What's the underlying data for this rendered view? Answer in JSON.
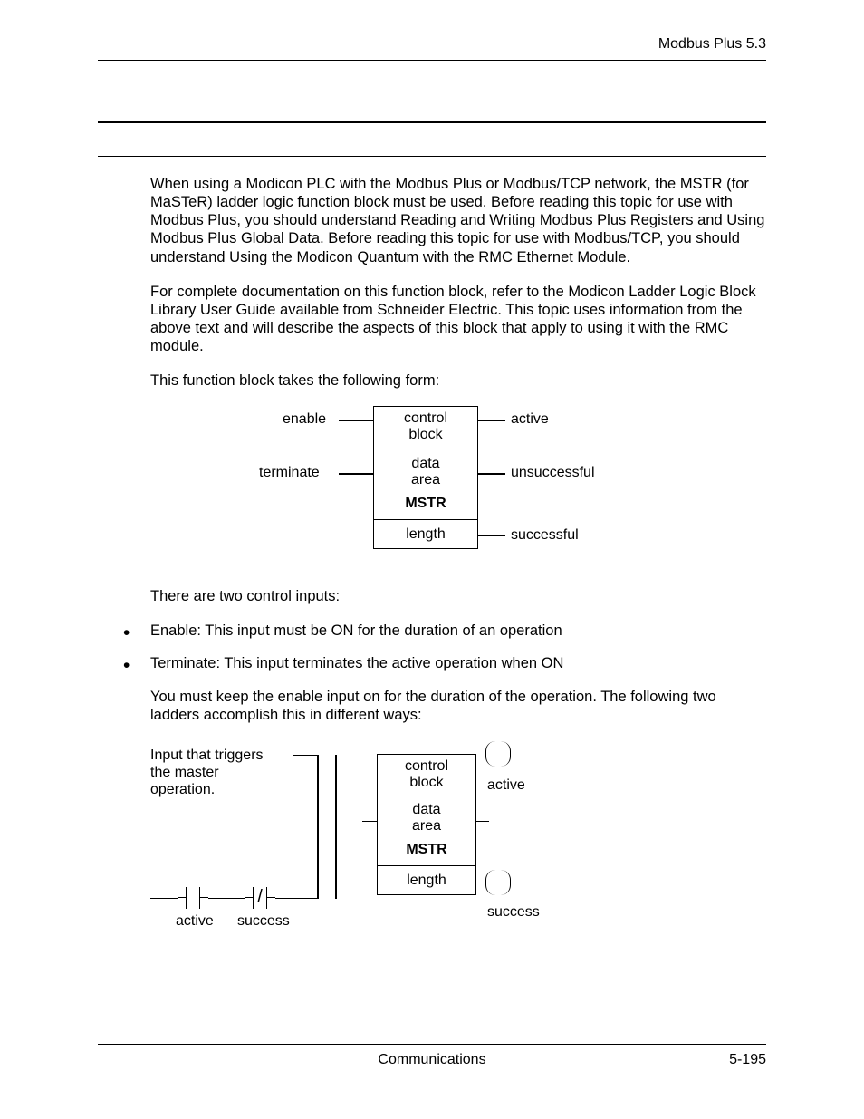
{
  "header": {
    "running": "Modbus Plus  5.3"
  },
  "para1": "When using a Modicon PLC with the Modbus Plus or Modbus/TCP network, the MSTR (for MaSTeR) ladder logic function block must be used. Before reading this topic for use with Modbus Plus, you should understand Reading and Writing Modbus Plus Registers and Using Modbus Plus Global Data. Before reading this topic for use with Modbus/TCP, you should understand Using the Modicon Quantum with the RMC Ethernet Module.",
  "para2": "For complete documentation on this function block, refer to the Modicon Ladder Logic Block Library User Guide available from Schneider Electric. This topic uses information from the above text and will describe the aspects of this block that apply to using it with the RMC module.",
  "para3": "This function block takes the following form:",
  "fig1": {
    "in1": "enable",
    "in2": "terminate",
    "out1": "active",
    "out2": "unsuccessful",
    "out3": "successful",
    "row_cb1": "control",
    "row_cb2": "block",
    "row_da1": "data",
    "row_da2": "area",
    "row_mstr": "MSTR",
    "row_len": "length"
  },
  "para4": "There are two control inputs:",
  "bullets": [
    "Enable: This input must be ON for the duration of an operation",
    "Terminate: This input terminates the active operation when ON"
  ],
  "para5": "You must keep the enable input on for the duration of the operation. The following two ladders accomplish this in different ways:",
  "fig2": {
    "trig1": "Input that triggers",
    "trig2": "the master",
    "trig3": "operation.",
    "row_cb1": "control",
    "row_cb2": "block",
    "row_da1": "data",
    "row_da2": "area",
    "row_mstr": "MSTR",
    "row_len": "length",
    "coil_active": "active",
    "coil_success": "success",
    "contact_active": "active",
    "contact_success": "success"
  },
  "footer": {
    "title": "Communications",
    "page": "5-195"
  }
}
